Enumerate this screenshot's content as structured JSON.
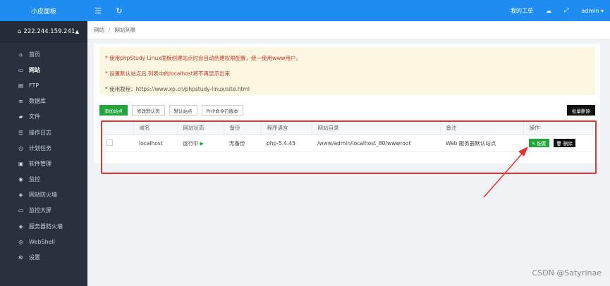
{
  "sidebar": {
    "brand": "小皮面板",
    "server_ip": "222.244.159.241",
    "items": [
      {
        "label": "首页",
        "icon": "home-icon",
        "glyph": "⌂"
      },
      {
        "label": "网站",
        "icon": "monitor-icon",
        "glyph": "▭",
        "active": true
      },
      {
        "label": "FTP",
        "icon": "ftp-icon",
        "glyph": "▤"
      },
      {
        "label": "数据库",
        "icon": "database-icon",
        "glyph": "≡"
      },
      {
        "label": "文件",
        "icon": "folder-icon",
        "glyph": "▰"
      },
      {
        "label": "操作日志",
        "icon": "log-icon",
        "glyph": "☰"
      },
      {
        "label": "计划任务",
        "icon": "clock-icon",
        "glyph": "◷"
      },
      {
        "label": "软件管理",
        "icon": "package-icon",
        "glyph": "▣"
      },
      {
        "label": "监控",
        "icon": "monitor-chart-icon",
        "glyph": "◉"
      },
      {
        "label": "网站防火墙",
        "icon": "shield-icon",
        "glyph": "◈"
      },
      {
        "label": "监控大屏",
        "icon": "screen-icon",
        "glyph": "▭"
      },
      {
        "label": "服务器防火墙",
        "icon": "firewall-icon",
        "glyph": "◈"
      },
      {
        "label": "WebShell",
        "icon": "terminal-icon",
        "glyph": "◎"
      },
      {
        "label": "设置",
        "icon": "gear-icon",
        "glyph": "⚙"
      }
    ]
  },
  "topbar": {
    "menu_icon": "☰",
    "refresh_icon": "↻",
    "tickets": "我的工单",
    "theme_icon": "☁",
    "fullscreen_icon": "⤢",
    "user": "admin ▾"
  },
  "breadcrumb": {
    "root": "网站",
    "sep": "/",
    "current": "网站列表"
  },
  "notice": {
    "lines": [
      "* 使用phpStudy Linux面板创建站点时会自动创建权限配置，统一使用www用户。",
      "* 设置默认站点后,列表中的localhost将不再显示出来",
      "* 使用教程：https://www.xp.cn/phpstudy-linux/site.html"
    ]
  },
  "toolbar": {
    "add": "添加站点",
    "edit_default_page": "修改默认页",
    "default_site": "默认站点",
    "php_cli": "PHP命令行版本",
    "batch_delete": "批量删除"
  },
  "table": {
    "headers": [
      "",
      "域名",
      "网站状态",
      "备份",
      "程序语言",
      "网站目录",
      "备注",
      "操作"
    ],
    "rows": [
      {
        "domain": "localhost",
        "status": "运行中",
        "backup": "无备份",
        "lang": "php-5.4.45",
        "dir": "/www/admin/localhost_80/wwwroot",
        "note": "Web 服务器默认站点",
        "cfg": "✎ 配置",
        "del": "🗑 删除"
      }
    ]
  },
  "watermark": "CSDN @Satyrinae",
  "colors": {
    "accent": "#1e8cf0",
    "sidebar": "#28313d",
    "green": "#20a53a",
    "highlight": "#e3342f"
  }
}
